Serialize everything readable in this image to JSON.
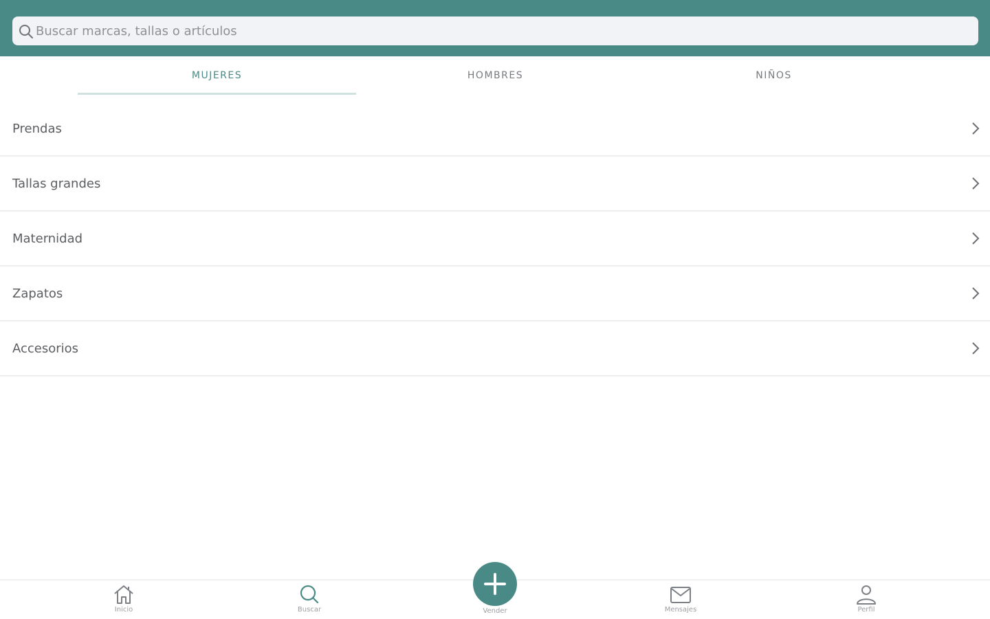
{
  "search": {
    "placeholder": "Buscar marcas, tallas o artículos",
    "icon": "search-icon"
  },
  "tabs": [
    {
      "label": "MUJERES",
      "active": true
    },
    {
      "label": "HOMBRES",
      "active": false
    },
    {
      "label": "NIÑOS",
      "active": false
    }
  ],
  "categories": [
    {
      "label": "Prendas"
    },
    {
      "label": "Tallas grandes"
    },
    {
      "label": "Maternidad"
    },
    {
      "label": "Zapatos"
    },
    {
      "label": "Accesorios"
    }
  ],
  "bottom_nav": {
    "home": {
      "label": "Inicio",
      "icon": "home-icon"
    },
    "search": {
      "label": "Buscar",
      "icon": "search-icon"
    },
    "sell": {
      "label": "Vender",
      "icon": "plus-icon"
    },
    "messages": {
      "label": "Mensajes",
      "icon": "mail-icon"
    },
    "profile": {
      "label": "Perfil",
      "icon": "user-icon"
    }
  },
  "colors": {
    "accent": "#4a8a86",
    "tab_underline": "#cfe2df",
    "search_bg": "#f2f3f6"
  }
}
